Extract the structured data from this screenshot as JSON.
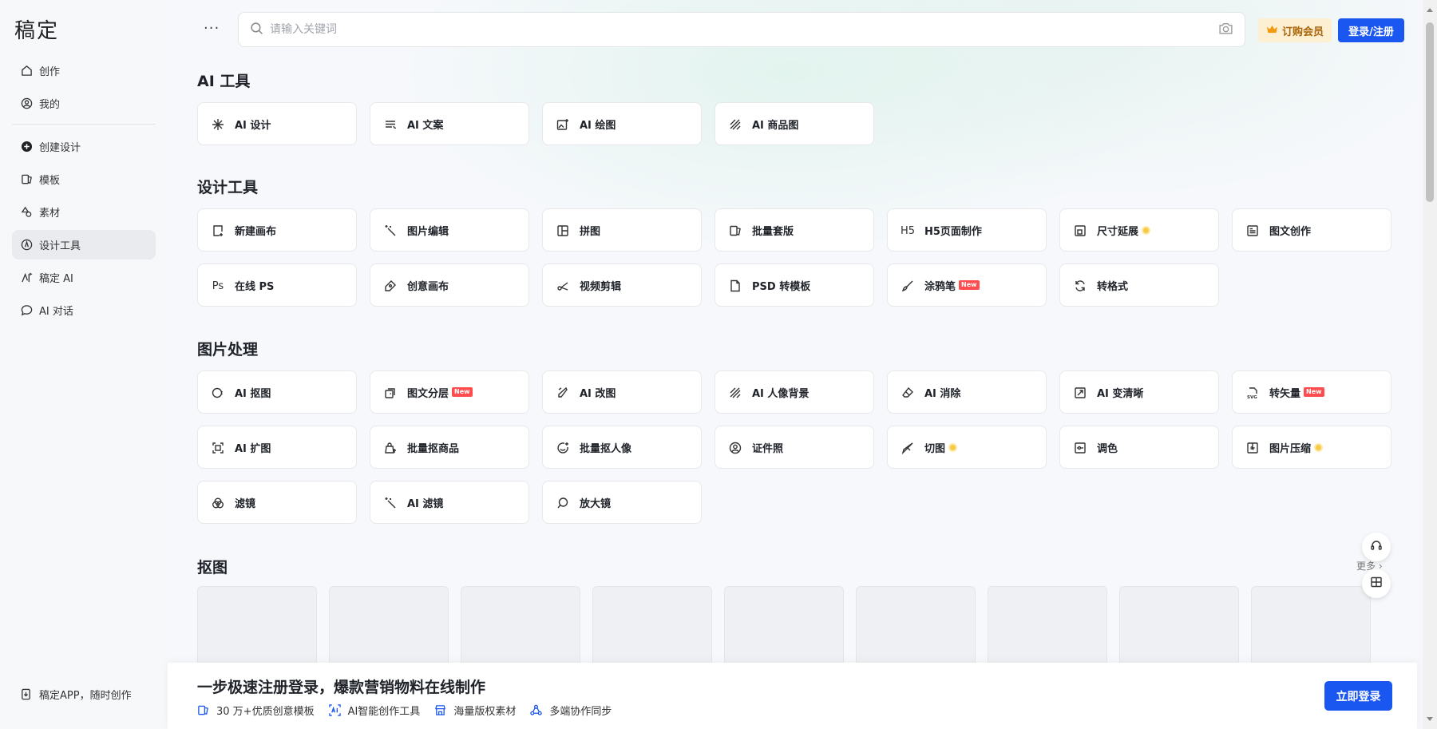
{
  "app": {
    "logo": "稿定"
  },
  "sidebar": {
    "items": [
      {
        "label": "创作",
        "icon": "home-icon"
      },
      {
        "label": "我的",
        "icon": "user-icon"
      },
      {
        "label": "创建设计",
        "icon": "plus-circle-icon"
      },
      {
        "label": "模板",
        "icon": "template-icon"
      },
      {
        "label": "素材",
        "icon": "shapes-icon"
      },
      {
        "label": "设计工具",
        "icon": "compass-icon",
        "active": true
      },
      {
        "label": "稿定 AI",
        "icon": "ai-icon"
      },
      {
        "label": "AI 对话",
        "icon": "chat-icon"
      }
    ],
    "app_link": "稿定APP，随时创作"
  },
  "header": {
    "more": "···",
    "search_placeholder": "请输入关键词",
    "vip_label": "订购会员",
    "login_label": "登录/注册"
  },
  "sections": {
    "ai_tools": {
      "title": "AI 工具",
      "items": [
        "AI 设计",
        "AI 文案",
        "AI 绘图",
        "AI 商品图"
      ]
    },
    "design_tools": {
      "title": "设计工具",
      "items": [
        "新建画布",
        "图片编辑",
        "拼图",
        "批量套版",
        "H5页面制作",
        "尺寸延展",
        "图文创作",
        "在线 PS",
        "创意画布",
        "视频剪辑",
        "PSD 转模板",
        "涂鸦笔",
        "转格式"
      ]
    },
    "image_processing": {
      "title": "图片处理",
      "items": [
        "AI 抠图",
        "图文分层",
        "AI 改图",
        "AI 人像背景",
        "AI 消除",
        "AI 变清晰",
        "转矢量",
        "AI 扩图",
        "批量抠商品",
        "批量抠人像",
        "证件照",
        "切图",
        "调色",
        "图片压缩",
        "滤镜",
        "AI 滤镜",
        "放大镜"
      ]
    },
    "cutout": {
      "title": "抠图",
      "more_label": "更多"
    }
  },
  "badges": {
    "new": "New"
  },
  "banner": {
    "title": "一步极速注册登录，爆款营销物料在线制作",
    "features": [
      "30 万+优质创意模板",
      "AI智能创作工具",
      "海量版权素材",
      "多端协作同步"
    ],
    "button": "立即登录"
  },
  "colors": {
    "accent": "#1a56f0",
    "vip_bg": "#fdefd2",
    "new_badge": "#ff4d4f"
  }
}
